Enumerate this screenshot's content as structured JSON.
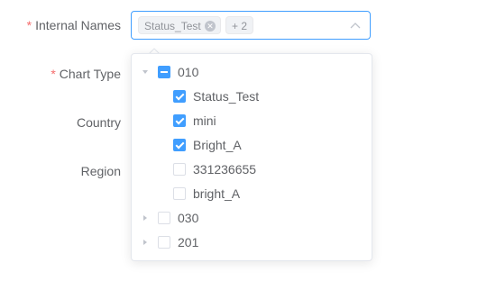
{
  "form": {
    "required_marker": "*",
    "labels": {
      "internal_names": "Internal Names",
      "chart_type": "Chart Type",
      "country": "Country",
      "region": "Region"
    }
  },
  "select": {
    "tags": [
      "Status_Test"
    ],
    "collapsed_count": "+ 2",
    "accent_color": "#409eff"
  },
  "tree": {
    "groups": [
      {
        "label": "010",
        "expanded": true,
        "state": "indeterminate",
        "children": [
          {
            "label": "Status_Test",
            "checked": true
          },
          {
            "label": "mini",
            "checked": true
          },
          {
            "label": "Bright_A",
            "checked": true
          },
          {
            "label": "331236655",
            "checked": false
          },
          {
            "label": "bright_A",
            "checked": false
          }
        ]
      },
      {
        "label": "030",
        "expanded": false,
        "state": "unchecked"
      },
      {
        "label": "201",
        "expanded": false,
        "state": "unchecked"
      }
    ]
  }
}
